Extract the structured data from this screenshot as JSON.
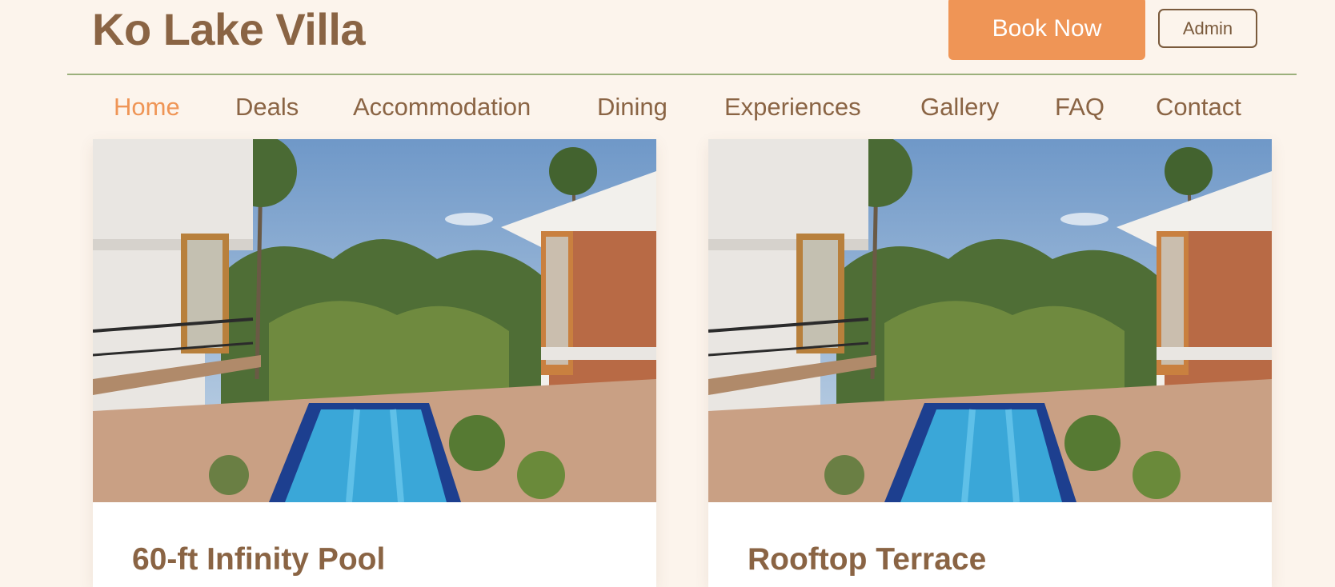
{
  "header": {
    "brand": "Ko Lake Villa",
    "book_now_label": "Book Now",
    "admin_label": "Admin"
  },
  "nav": {
    "items": [
      {
        "label": "Home",
        "active": true
      },
      {
        "label": "Deals"
      },
      {
        "label": "Accommodation"
      },
      {
        "label": "Dining"
      },
      {
        "label": "Experiences"
      },
      {
        "label": "Gallery"
      },
      {
        "label": "FAQ"
      },
      {
        "label": "Contact"
      }
    ]
  },
  "cards": [
    {
      "title": "60-ft Infinity Pool",
      "image": "villa-pool-courtyard-photo"
    },
    {
      "title": "Rooftop Terrace",
      "image": "villa-pool-courtyard-photo"
    }
  ],
  "colors": {
    "background": "#fcf4ec",
    "brand_text": "#8a6444",
    "accent": "#ef9556",
    "divider": "#9bb07c"
  }
}
